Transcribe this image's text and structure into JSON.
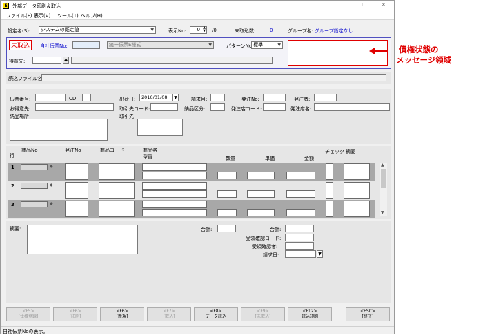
{
  "window": {
    "title": "外部データ印刷＆取込",
    "controls": [
      "—",
      "☐",
      "✕"
    ]
  },
  "menu": [
    "ファイル(F)",
    "表示(V)",
    "ツール(T)",
    "ヘルプ(H)"
  ],
  "header": {
    "setting_label": "設定名(S):",
    "setting_value": "システムの既定値",
    "display_no_label": "表示No:",
    "display_no_value": "0",
    "display_total": "/0",
    "unimported_label": "未取込数:",
    "unimported_value": "0",
    "group_label": "グループ名:",
    "group_value": "グループ指定なし"
  },
  "status_panel": {
    "badge": "未取込",
    "slip_no_label": "自社伝票No:",
    "slip_format": "統一伝票E様式",
    "pattern_label": "パターンNo:",
    "pattern_value": "標準",
    "customer_label": "得意先:"
  },
  "annotation": {
    "line1": "債権状態の",
    "line2": "メッセージ領域",
    "color": "#e00000"
  },
  "file_label": "読込ファイル名:",
  "form": {
    "slip_number": "伝票番号:",
    "cd": "CD:",
    "ship_date_label": "出荷日:",
    "ship_date_value": "2016/01/08",
    "billing_month": "請求月:",
    "order_no": "発注No:",
    "orderer": "発注者:",
    "customer": "お得意先:",
    "partner_code": "取引先コード:",
    "delivery_class": "納品区分:",
    "order_store_code": "発注店コード:",
    "order_store_name": "発注店名:",
    "delivery_place": "納品場所",
    "partner": "取引先"
  },
  "grid": {
    "row_col": "行",
    "headers": {
      "product_no": "商品No",
      "order_no": "発注No",
      "product_code": "商品コード",
      "product_name": "商品名",
      "model": "型番",
      "qty": "数量",
      "unit_price": "単価",
      "amount": "金額",
      "check": "チェック",
      "remarks": "摘要"
    },
    "rows": [
      "1",
      "2",
      "3"
    ]
  },
  "footer": {
    "remarks_label": "摘要:",
    "total_label": "合計:",
    "total2_label": "合計:",
    "confirm_code": "受領確認コード:",
    "confirmer": "受領確認者:",
    "billing_date": "請求日:"
  },
  "buttons": [
    {
      "key": "<F5>",
      "label": "[仕様登録]",
      "enabled": false
    },
    {
      "key": "<F6>",
      "label": "[印刷]",
      "enabled": false
    },
    {
      "key": "<F6>",
      "label": "[新規]",
      "enabled": true
    },
    {
      "key": "<F7>",
      "label": "[取込]",
      "enabled": false
    },
    {
      "key": "<F8>",
      "label": "データ読込",
      "enabled": true
    },
    {
      "key": "<F9>",
      "label": "[未取込]",
      "enabled": false
    },
    {
      "key": "<F12>",
      "label": "読込印刷",
      "enabled": true
    },
    {
      "key": "<ESC>",
      "label": "[終了]",
      "enabled": true
    }
  ],
  "statusbar": "自社伝票Noの表示。"
}
